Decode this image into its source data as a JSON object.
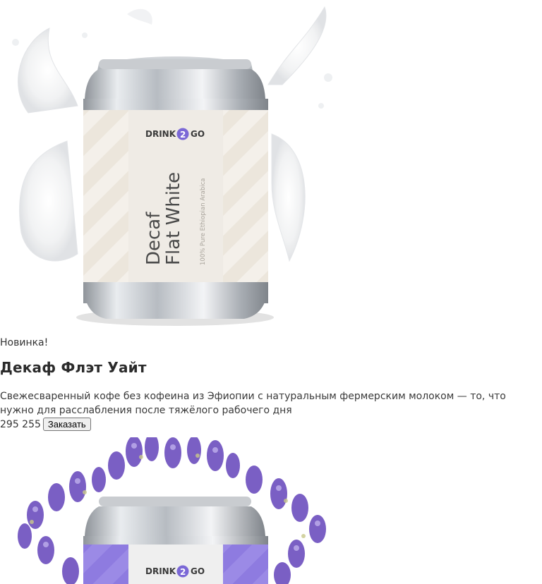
{
  "products": [
    {
      "badge": "Новинка!",
      "title": "Декаф Флэт Уайт",
      "description": "Свежесваренный кофе без кофеина из Эфиопии с натуральным фермерским молоком — то, что нужно для расслабления после тяжёлого рабочего дня",
      "price": "295 255",
      "order_label": "Заказать",
      "can": {
        "brand_left": "DRINK",
        "brand_num": "2",
        "brand_right": "GO",
        "line1": "Decaf",
        "line2": "Flat White",
        "subtitle": "100% Pure Ethiopian Arabica",
        "label_color": "#ece6dc",
        "accent": "#7b68d6",
        "decoration": "milk-splash"
      }
    },
    {
      "can": {
        "brand_left": "DRINK",
        "brand_num": "2",
        "brand_right": "GO",
        "label_color": "#8e7be0",
        "accent": "#7b68d6",
        "decoration": "lavender"
      }
    }
  ]
}
